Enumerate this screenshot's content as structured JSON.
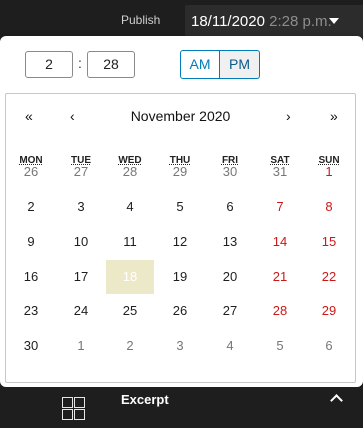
{
  "header": {
    "publish_label": "Publish",
    "date": "18/11/2020",
    "time": "2:28 p.m."
  },
  "time": {
    "hours": "2",
    "minutes": "28",
    "colon": ":",
    "am_label": "AM",
    "pm_label": "PM",
    "selected_period": "PM"
  },
  "calendar": {
    "month_title": "November 2020",
    "nav": {
      "first": "«",
      "prev": "‹",
      "next": "›",
      "last": "»"
    },
    "weekdays": [
      "MON",
      "TUE",
      "WED",
      "THU",
      "FRI",
      "SAT",
      "SUN"
    ],
    "weeks": [
      [
        "26",
        "27",
        "28",
        "29",
        "30",
        "31",
        "1"
      ],
      [
        "2",
        "3",
        "4",
        "5",
        "6",
        "7",
        "8"
      ],
      [
        "9",
        "10",
        "11",
        "12",
        "13",
        "14",
        "15"
      ],
      [
        "16",
        "17",
        "18",
        "19",
        "20",
        "21",
        "22"
      ],
      [
        "23",
        "24",
        "25",
        "26",
        "27",
        "28",
        "29"
      ],
      [
        "30",
        "1",
        "2",
        "3",
        "4",
        "5",
        "6"
      ]
    ],
    "selected_day": "18",
    "weekend_color": "#cc1818",
    "selected_bg": "#ece9c8"
  },
  "bottom": {
    "section_label": "Excerpt",
    "icon": "grid-icon",
    "toggle_icon": "chevron-up-icon"
  },
  "colors": {
    "accent": "#007cba",
    "dark_bg": "#1e1e1e"
  }
}
